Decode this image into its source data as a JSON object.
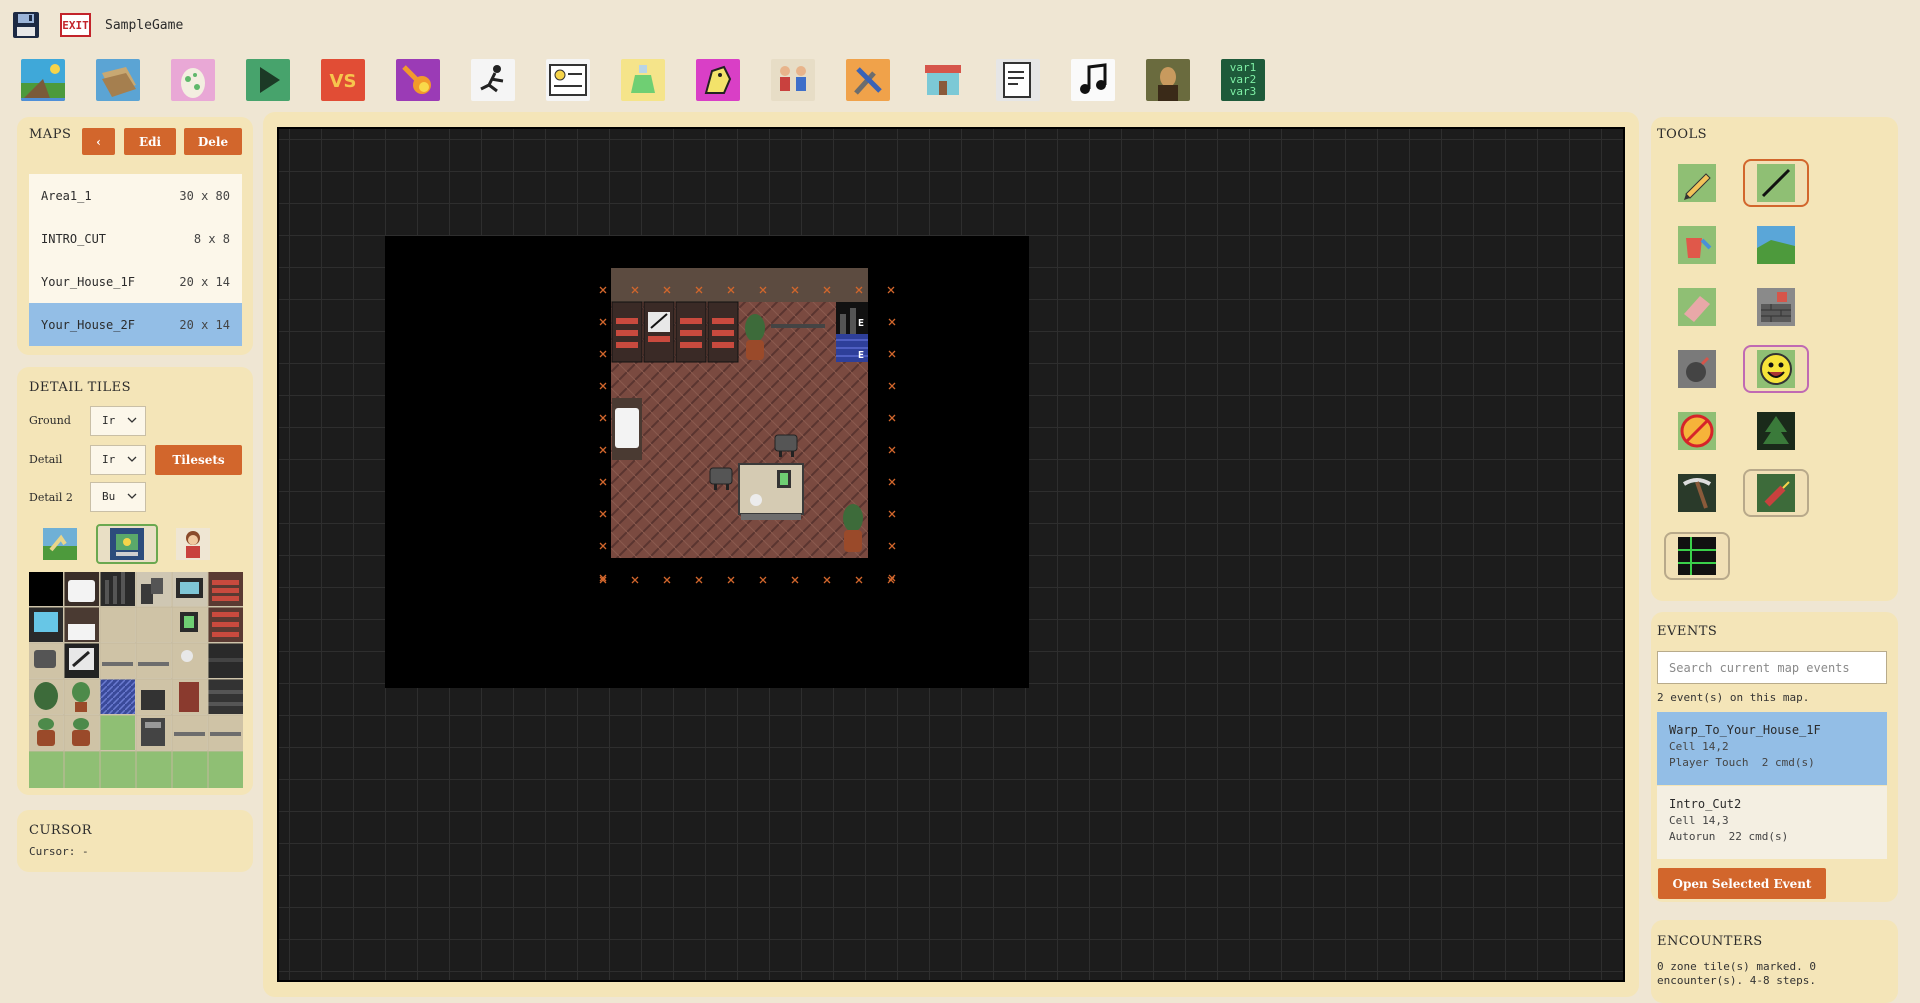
{
  "app": {
    "game_title": "SampleGame",
    "exit_label": "EXIT"
  },
  "toolbar": [
    {
      "name": "map-editor-icon"
    },
    {
      "name": "tileset-icon"
    },
    {
      "name": "egg-icon"
    },
    {
      "name": "play-icon"
    },
    {
      "name": "vs-battle-icon"
    },
    {
      "name": "fireball-icon"
    },
    {
      "name": "running-icon"
    },
    {
      "name": "id-card-icon"
    },
    {
      "name": "potion-icon"
    },
    {
      "name": "monster-icon"
    },
    {
      "name": "characters-icon"
    },
    {
      "name": "wrench-icon"
    },
    {
      "name": "shop-icon"
    },
    {
      "name": "script-icon"
    },
    {
      "name": "music-icon"
    },
    {
      "name": "portrait-icon"
    },
    {
      "name": "variables-icon"
    }
  ],
  "variables_icon_lines": [
    "var1",
    "var2",
    "var3"
  ],
  "maps": {
    "title": "MAPS",
    "back_label": "‹",
    "edit_label": "Edi",
    "delete_label": "Dele",
    "items": [
      {
        "name": "Area1_1",
        "size": "30 x 80"
      },
      {
        "name": "INTRO_CUT",
        "size": "8 x 8"
      },
      {
        "name": "Your_House_1F",
        "size": "20 x 14"
      },
      {
        "name": "Your_House_2F",
        "size": "20 x 14"
      }
    ],
    "selected_index": 3
  },
  "detail_tiles": {
    "title": "DETAIL TILES",
    "ground_label": "Ground",
    "ground_value": "Ir",
    "detail_label": "Detail",
    "detail_value": "Ir",
    "detail2_label": "Detail 2",
    "detail2_value": "Bu",
    "tilesets_label": "Tilesets"
  },
  "cursor": {
    "title": "CURSOR",
    "text": "Cursor: -"
  },
  "tools": {
    "title": "TOOLS"
  },
  "events": {
    "title": "EVENTS",
    "search_placeholder": "Search current map events",
    "count_text": "2 event(s) on this map.",
    "items": [
      {
        "name": "Warp_To_Your_House_1F",
        "cell": "Cell 14,2",
        "trigger": "Player Touch  2 cmd(s)"
      },
      {
        "name": "Intro_Cut2",
        "cell": "Cell 14,3",
        "trigger": "Autorun  22 cmd(s)"
      }
    ],
    "open_label": "Open Selected Event"
  },
  "encounters": {
    "title": "ENCOUNTERS",
    "line1": "0 zone tile(s) marked. 0",
    "line2": "encounter(s). 4-8 steps."
  },
  "map_markers": {
    "event_label": "E"
  },
  "colors": {
    "accent": "#d2662c",
    "selected_row": "#93bee6",
    "panel": "#f4e5b8",
    "background": "#efe6d3"
  }
}
